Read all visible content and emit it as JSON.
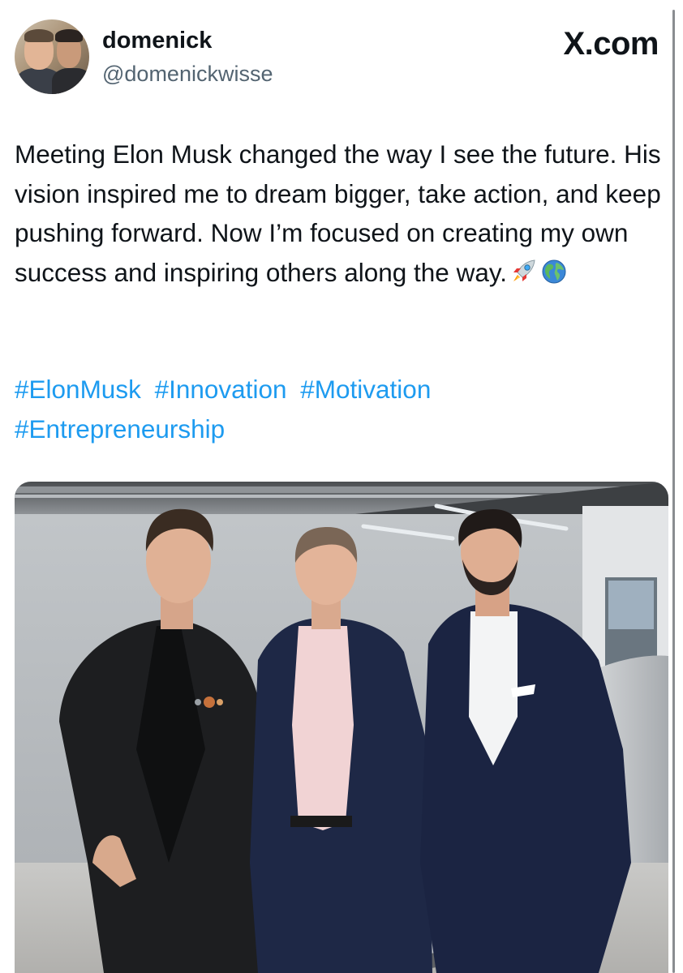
{
  "post": {
    "author": {
      "display_name": "domenick",
      "handle": "@domenickwisse"
    },
    "site_label": "X.com",
    "text": "Meeting Elon Musk changed the way I see the future. His vision inspired me to dream bigger, take action, and keep pushing forward. Now I’m focused on creating my own success and inspiring others along the way.",
    "emojis": [
      "rocket-icon",
      "globe-icon"
    ],
    "hashtags": [
      "#ElonMusk",
      "#Innovation",
      "#Motivation",
      "#Entrepreneurship"
    ]
  },
  "colors": {
    "text": "#0f1419",
    "secondary": "#536471",
    "link": "#1d9bf0"
  }
}
